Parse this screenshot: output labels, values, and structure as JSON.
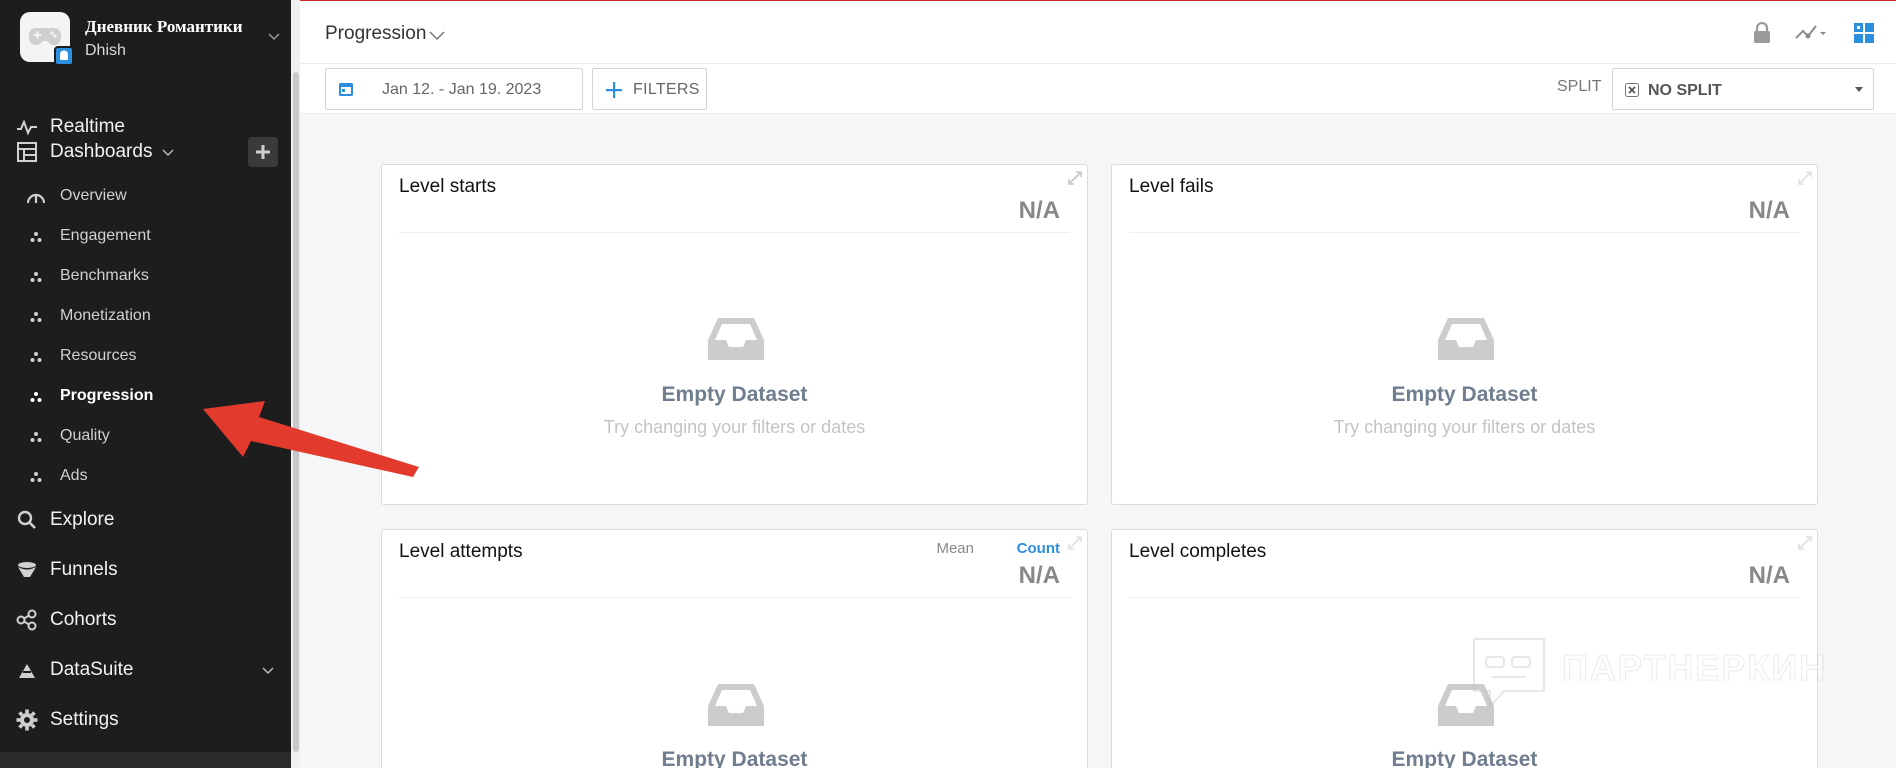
{
  "game": {
    "title": "Дневник Романтики",
    "subtitle": "Dhish"
  },
  "nav": {
    "realtime": "Realtime",
    "dashboards": "Dashboards",
    "dashboard_items": [
      "Overview",
      "Engagement",
      "Benchmarks",
      "Monetization",
      "Resources",
      "Progression",
      "Quality",
      "Ads"
    ],
    "active_dashboard": "Progression",
    "explore": "Explore",
    "funnels": "Funnels",
    "cohorts": "Cohorts",
    "datasuite": "DataSuite",
    "settings": "Settings"
  },
  "header": {
    "title": "Progression"
  },
  "filters": {
    "date_range": "Jan 12. - Jan 19. 2023",
    "filters_label": "FILTERS",
    "split_label": "SPLIT",
    "split_value": "NO SPLIT"
  },
  "cards": [
    {
      "title": "Level starts",
      "value": "N/A",
      "empty_title": "Empty Dataset",
      "empty_sub": "Try changing your filters or dates"
    },
    {
      "title": "Level fails",
      "value": "N/A",
      "empty_title": "Empty Dataset",
      "empty_sub": "Try changing your filters or dates"
    },
    {
      "title": "Level attempts",
      "value": "N/A",
      "toggle_mean": "Mean",
      "toggle_count": "Count",
      "empty_title": "Empty Dataset"
    },
    {
      "title": "Level completes",
      "value": "N/A",
      "empty_title": "Empty Dataset"
    }
  ],
  "watermark": "ПАРТНЕРКИН",
  "colors": {
    "sidebar_bg": "#1d1d1d",
    "accent": "#2b8fe0",
    "arrow": "#e23b2e",
    "empty_title": "#6f7d8f"
  }
}
